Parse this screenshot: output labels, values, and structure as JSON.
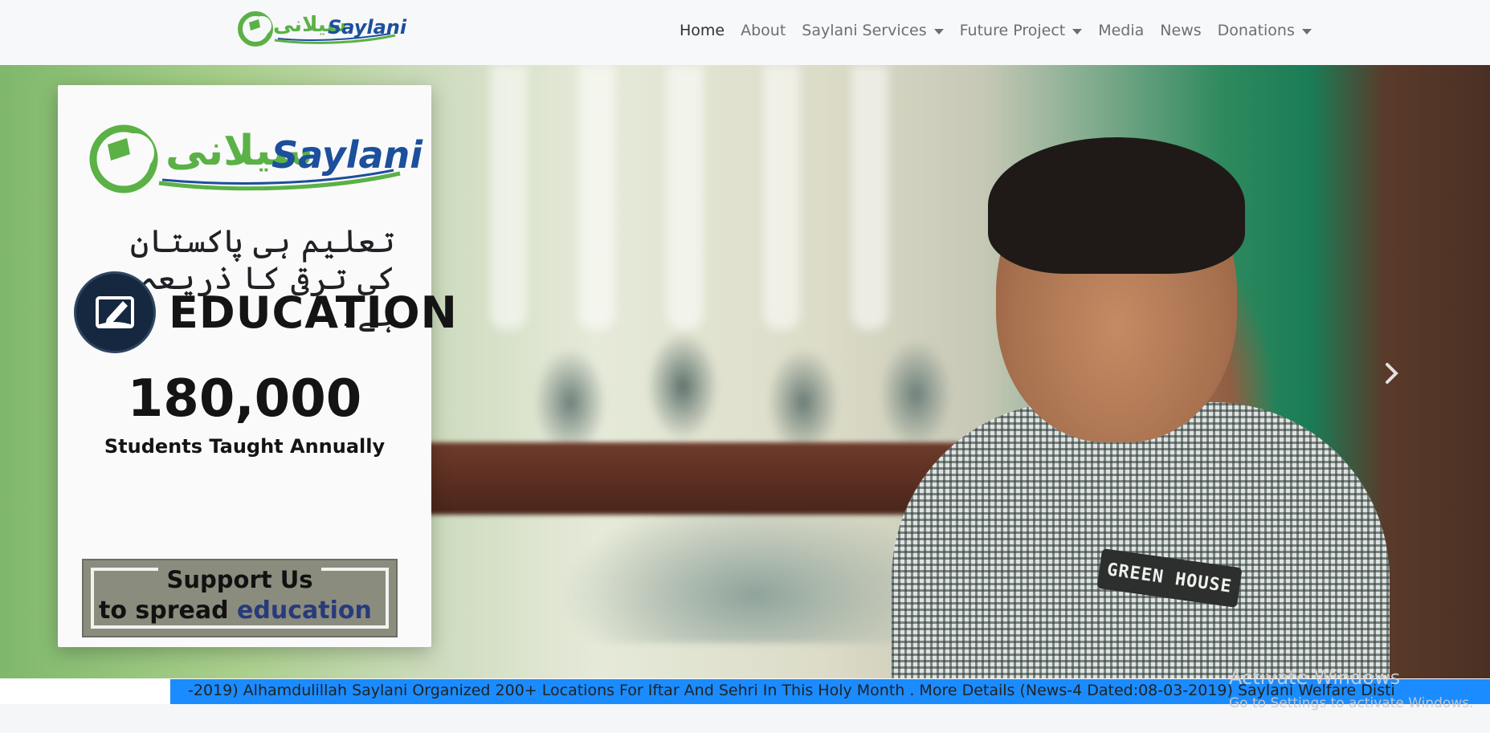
{
  "brand": {
    "logo_text": "Saylani",
    "logo_urdu": "سیلانی"
  },
  "nav": {
    "items": [
      {
        "label": "Home",
        "active": true,
        "dropdown": false
      },
      {
        "label": "About",
        "active": false,
        "dropdown": false
      },
      {
        "label": "Saylani Services",
        "active": false,
        "dropdown": true
      },
      {
        "label": "Future Project",
        "active": false,
        "dropdown": true
      },
      {
        "label": "Media",
        "active": false,
        "dropdown": false
      },
      {
        "label": "News",
        "active": false,
        "dropdown": false
      },
      {
        "label": "Donations",
        "active": false,
        "dropdown": true
      }
    ]
  },
  "hero": {
    "card": {
      "logo_text": "Saylani",
      "logo_urdu": "سیلانی",
      "urdu_tagline": "تعلیم ہی پاکستان کی ترقی کا ذریعہ ہے۔",
      "education_label": "EDUCATION",
      "stat_number": "180,000",
      "stat_caption": "Students Taught Annually",
      "support_line1": "Support Us",
      "support_line2_prefix": "to spread ",
      "support_line2_highlight": "education"
    },
    "photo_patch_text": "GREEN HOUSE",
    "next_icon": "chevron-right-icon"
  },
  "ticker": {
    "text": "-2019) Alhamdulillah Saylani Organized 200+ Locations For Iftar And Sehri In This Holy Month . More Details (News-4 Dated:08-03-2019) Saylani Welfare Disti"
  },
  "watermark": {
    "title": "Activate Windows",
    "subtitle": "Go to Settings to activate Windows."
  },
  "colors": {
    "brand_green": "#5bb146",
    "brand_blue": "#1c4f9c",
    "ticker_bg": "#1a8cff",
    "education_icon_bg": "#152840",
    "support_highlight": "#283a7a"
  }
}
